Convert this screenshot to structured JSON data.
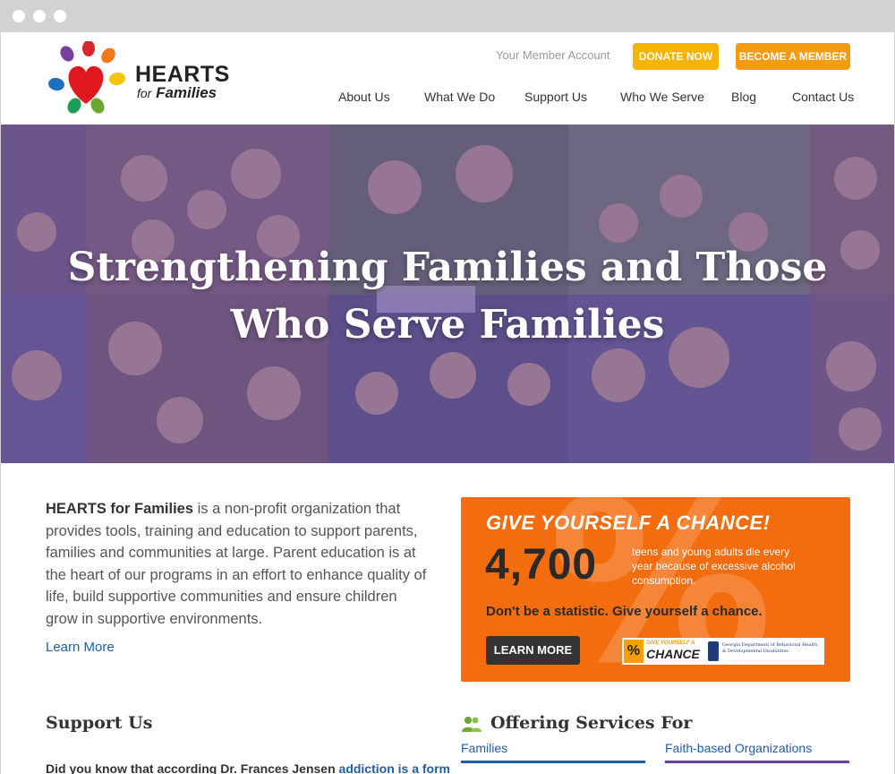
{
  "header": {
    "logo": {
      "line1": "HEARTS",
      "line2_small": "for",
      "line2": "Families"
    },
    "member_account": "Your Member Account",
    "donate_label": "DONATE NOW",
    "become_member_label": "BECOME A MEMBER",
    "nav": [
      "About Us",
      "What We Do",
      "Support Us",
      "Who We Serve",
      "Blog",
      "Contact Us"
    ]
  },
  "hero": {
    "title_line1": "Strengthening Families and Those",
    "title_line2": "Who Serve Families"
  },
  "intro": {
    "org_name": "HEARTS for Families",
    "body": " is a non-profit organization that provides tools, training and education to support parents, families and communities at large. Parent education is at the heart of our programs in an effort to enhance quality of life, build supportive communities and ensure children grow in supportive environments.",
    "learn_more": "Learn More"
  },
  "promo": {
    "background_glyph": "%",
    "headline": "GIVE YOURSELF A CHANCE!",
    "number": "4,700",
    "description": "teens and young adults die every year because of excessive alcohol consumption.",
    "tagline": "Don't be a statistic. Give yourself a chance.",
    "button_label": "LEARN MORE",
    "badge_pct": "%",
    "badge_top": "GIVE YOURSELF A",
    "badge_chance": "CHANCE",
    "agency_text": "Georgia Department of Behavioral Health & Developmental Disabilities"
  },
  "support": {
    "heading": "Support Us",
    "text_start": "Did you know that according Dr. Frances Jensen ",
    "text_link": "addiction is a form"
  },
  "services": {
    "heading": "Offering Services For",
    "items": [
      "Families",
      "Faith-based Organizations"
    ]
  },
  "colors": {
    "donate": "#f5b400",
    "member": "#f39c12",
    "promo": "#f36c0e",
    "hero_tint": "#5a3ca0",
    "link": "#1f5ea8",
    "faith_bar": "#6b3fa0"
  }
}
